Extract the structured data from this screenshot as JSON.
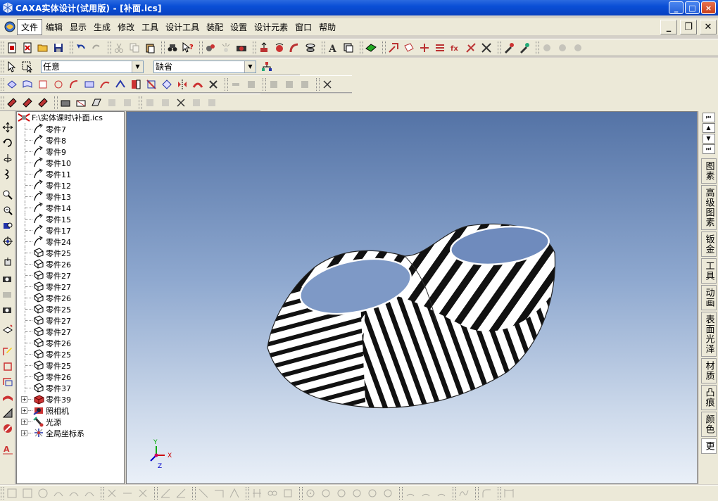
{
  "window": {
    "title": "CAXA实体设计(试用版) - [补面.ics]",
    "minimize": "_",
    "maximize": "□",
    "close": "×"
  },
  "menu": {
    "items": [
      "文件",
      "编辑",
      "显示",
      "生成",
      "修改",
      "工具",
      "设计工具",
      "装配",
      "设置",
      "设计元素",
      "窗口",
      "帮助"
    ],
    "mdi_minimize": "_",
    "mdi_restore": "❐",
    "mdi_close": "✕"
  },
  "selector": {
    "filter_value": "任意",
    "mode_value": "缺省"
  },
  "tree": {
    "root_label": "F:\\实体课时\\补面.ics",
    "parts": [
      "零件7",
      "零件8",
      "零件9",
      "零件10",
      "零件11",
      "零件12",
      "零件13",
      "零件14",
      "零件15",
      "零件17",
      "零件24",
      "零件25",
      "零件26",
      "零件27",
      "零件27",
      "零件26",
      "零件25",
      "零件27",
      "零件27",
      "零件26",
      "零件25",
      "零件25",
      "零件26",
      "零件37"
    ],
    "groups": [
      "零件39",
      "照相机",
      "光源",
      "全局坐标系"
    ]
  },
  "axes": {
    "x": "X",
    "y": "Y",
    "z": "Z"
  },
  "right_tabs": [
    "图素",
    "高级图素",
    "钣金",
    "工具",
    "动画",
    "表面光泽",
    "材质",
    "凸痕",
    "颜色",
    "更"
  ],
  "colors": {
    "titlebar": "#0a4fd6",
    "viewport_top": "#5473a6",
    "viewport_bottom": "#eaf0f8"
  }
}
